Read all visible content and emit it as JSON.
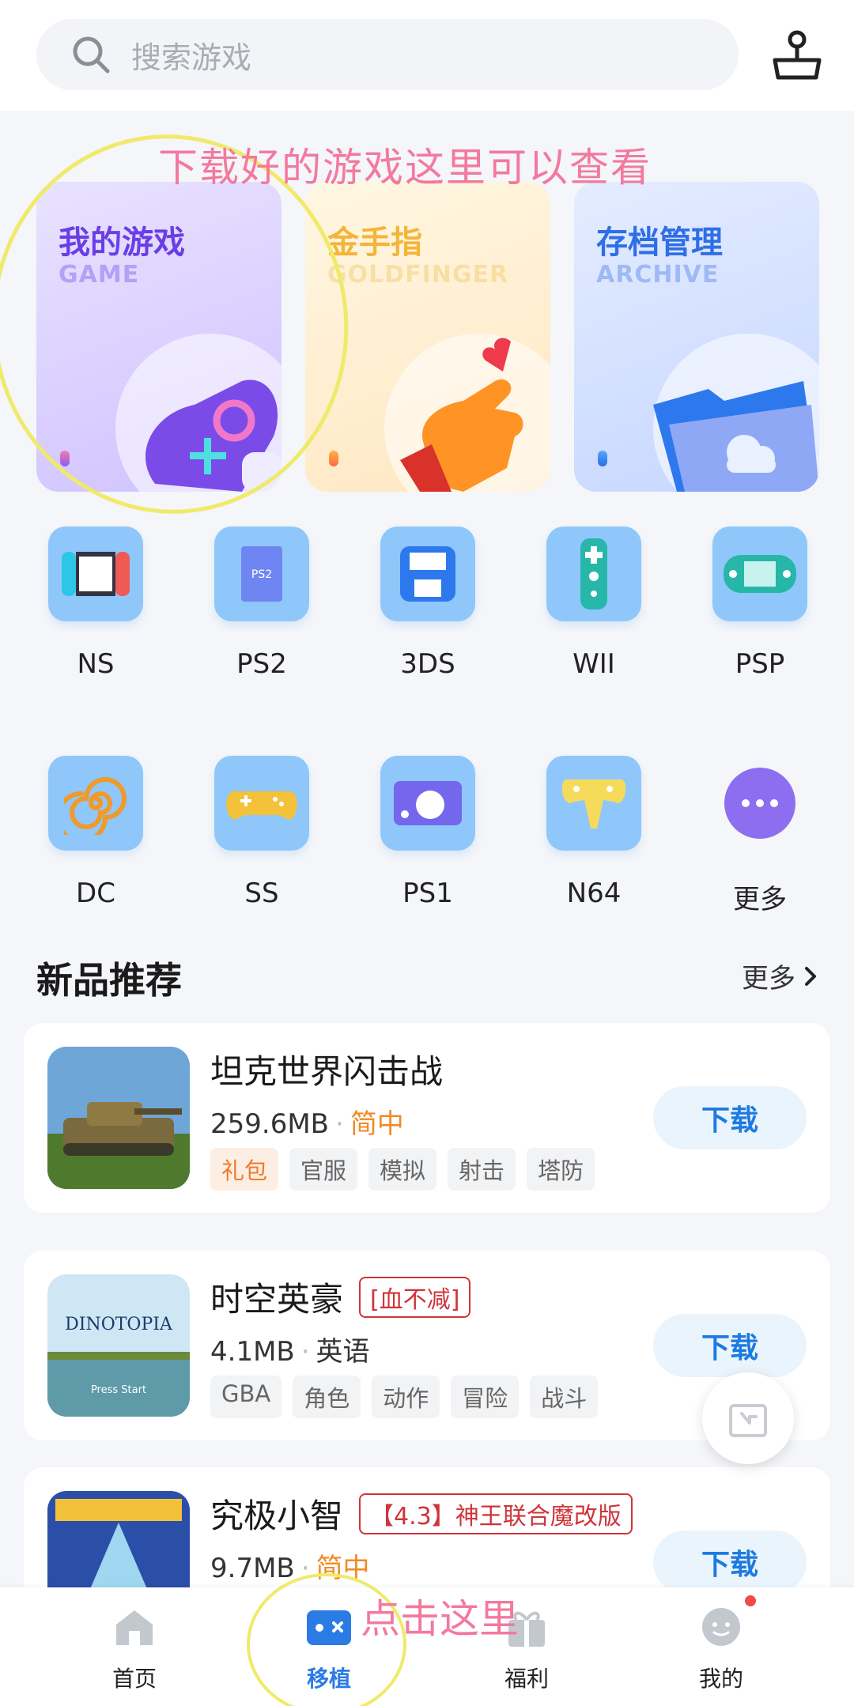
{
  "search": {
    "placeholder": "搜索游戏"
  },
  "annotations": {
    "top": "下载好的游戏这里可以查看",
    "bottom": "点击这里"
  },
  "feature_cards": [
    {
      "title": "我的游戏",
      "subtitle": "GAME"
    },
    {
      "title": "金手指",
      "subtitle": "GOLDFINGER"
    },
    {
      "title": "存档管理",
      "subtitle": "ARCHIVE"
    }
  ],
  "platforms_row1": [
    "NS",
    "PS2",
    "3DS",
    "WII",
    "PSP"
  ],
  "platforms_row2": [
    "DC",
    "SS",
    "PS1",
    "N64",
    "更多"
  ],
  "new_section": {
    "title": "新品推荐",
    "more": "更多"
  },
  "games": [
    {
      "name": "坦克世界闪击战",
      "size": "259.6MB",
      "lang": "简中",
      "tags": [
        "礼包",
        "官服",
        "模拟",
        "射击",
        "塔防"
      ],
      "download": "下载"
    },
    {
      "name": "时空英豪",
      "badge": "[血不减]",
      "size": "4.1MB",
      "lang": "英语",
      "tags": [
        "GBA",
        "角色",
        "动作",
        "冒险",
        "战斗"
      ],
      "download": "下载",
      "cover_title": "DINOTOPIA",
      "cover_sub": "Press Start"
    },
    {
      "name": "究极小智",
      "badge": "【4.3】神王联合魔改版",
      "size": "9.7MB",
      "lang": "简中",
      "download": "下载"
    }
  ],
  "tabs": [
    "首页",
    "移植",
    "福利",
    "我的"
  ],
  "colors": {
    "accent": "#2b7be4",
    "annotation": "#f3799e",
    "orange": "#f08a24",
    "badge_red": "#d0343a"
  }
}
